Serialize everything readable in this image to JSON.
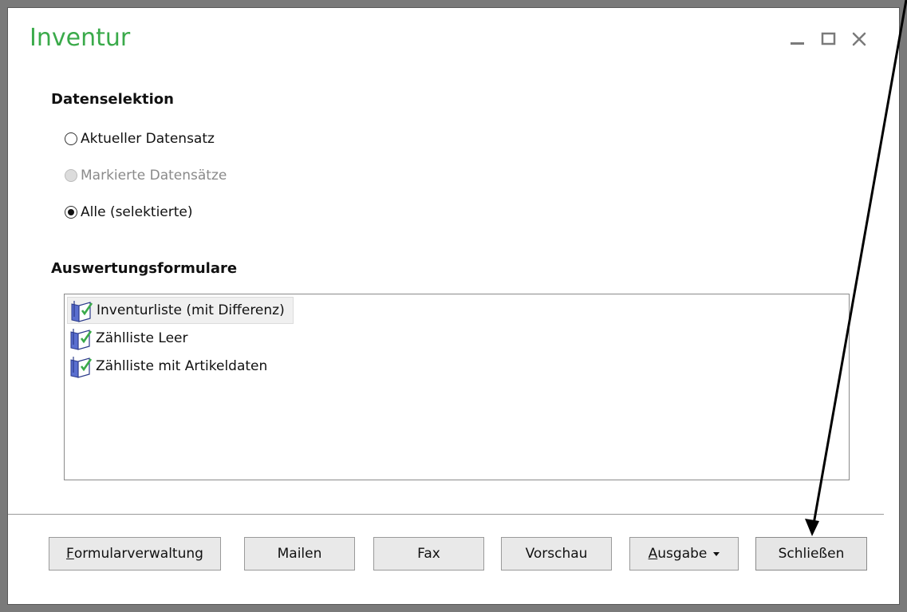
{
  "window": {
    "title": "Inventur",
    "accent_color": "#3aaa4a",
    "controls": [
      "minimize-icon",
      "maximize-icon",
      "close-icon"
    ]
  },
  "data_selection": {
    "label": "Datenselektion",
    "options": [
      {
        "label": "Aktueller Datensatz",
        "checked": false,
        "disabled": false
      },
      {
        "label": "Markierte Datensätze",
        "checked": false,
        "disabled": true
      },
      {
        "label": "Alle (selektierte)",
        "checked": true,
        "disabled": false
      }
    ]
  },
  "forms": {
    "label": "Auswertungsformulare",
    "items": [
      {
        "label": "Inventurliste (mit Differenz)",
        "selected": true,
        "icon": "report-form-icon"
      },
      {
        "label": "Zählliste Leer",
        "selected": false,
        "icon": "report-form-icon"
      },
      {
        "label": "Zählliste mit Artikeldaten",
        "selected": false,
        "icon": "report-form-icon"
      }
    ]
  },
  "buttons": {
    "formularverwaltung": {
      "first": "F",
      "rest": "ormularverwaltung"
    },
    "mailen": "Mailen",
    "fax": "Fax",
    "vorschau": "Vorschau",
    "ausgabe": {
      "first": "A",
      "rest": "usgabe"
    },
    "schliessen": "Schließen"
  },
  "annotation": {
    "type": "arrow",
    "points_to": "Schließen"
  }
}
